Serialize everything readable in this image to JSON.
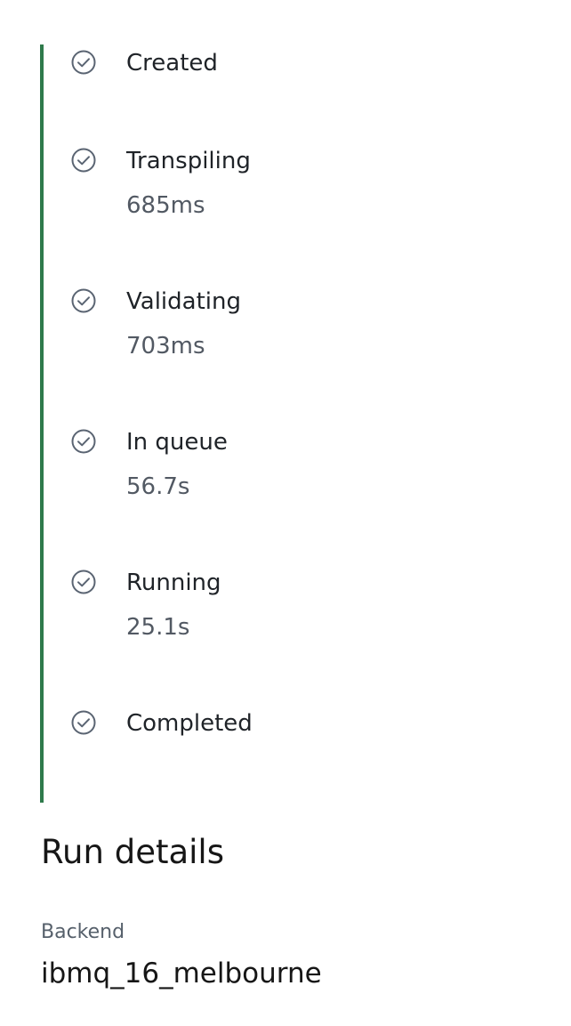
{
  "timeline": {
    "steps": [
      {
        "label": "Created",
        "duration": "",
        "icon": "check-circle-icon"
      },
      {
        "label": "Transpiling",
        "duration": "685ms",
        "icon": "check-circle-icon"
      },
      {
        "label": "Validating",
        "duration": "703ms",
        "icon": "check-circle-icon"
      },
      {
        "label": "In queue",
        "duration": "56.7s",
        "icon": "check-circle-icon"
      },
      {
        "label": "Running",
        "duration": "25.1s",
        "icon": "check-circle-icon"
      },
      {
        "label": "Completed",
        "duration": "",
        "icon": "check-circle-icon"
      }
    ],
    "progress_color": "#2f7a4b",
    "icon_color": "#5a6472"
  },
  "run_details": {
    "title": "Run details",
    "backend_label": "Backend",
    "backend_value": "ibmq_16_melbourne"
  }
}
